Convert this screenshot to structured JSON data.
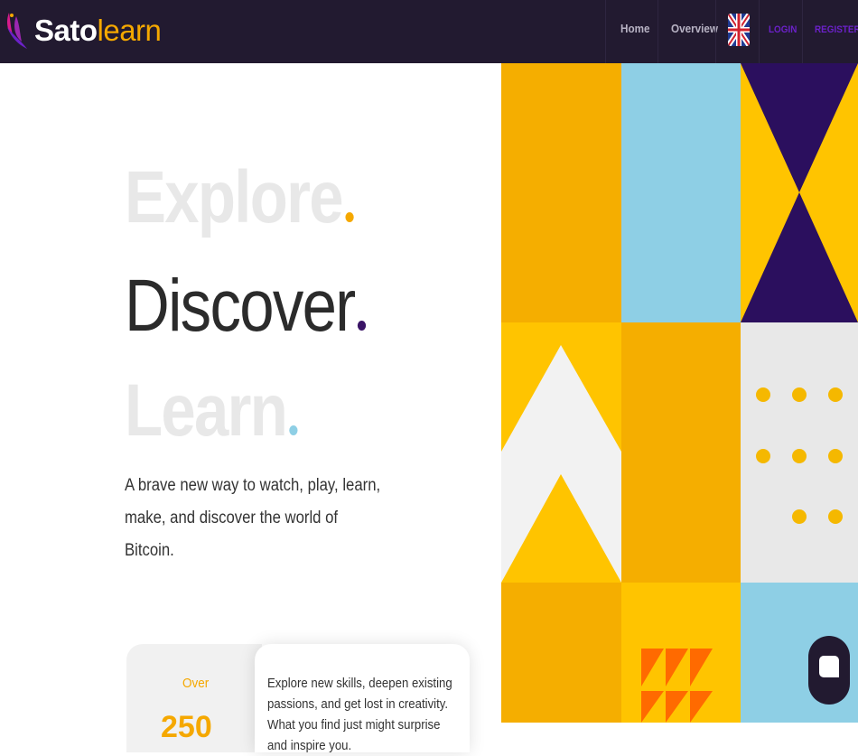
{
  "brand": {
    "name_part1": "Sato",
    "name_part2": "learn",
    "accent_color": "#f5a800",
    "dark_color": "#221a30",
    "purple_color": "#6b21c8",
    "sky_color": "#8ecfe5"
  },
  "nav": {
    "home": "Home",
    "overview": "Overview",
    "language_icon": "uk-flag-icon",
    "login": "LOGIN",
    "register": "REGISTER"
  },
  "hero": {
    "line1": "Explore",
    "line2": "Discover",
    "line3": "Learn",
    "subtitle": "A brave new way to watch, play, learn, make, and discover the world of Bitcoin."
  },
  "stats_card": {
    "over_label": "Over",
    "number_partial": "250",
    "description": "Explore new skills, deepen existing passions, and get lost in creativity. What you find just might surprise and inspire you."
  },
  "chat": {
    "icon": "chat-bubble-icon"
  }
}
